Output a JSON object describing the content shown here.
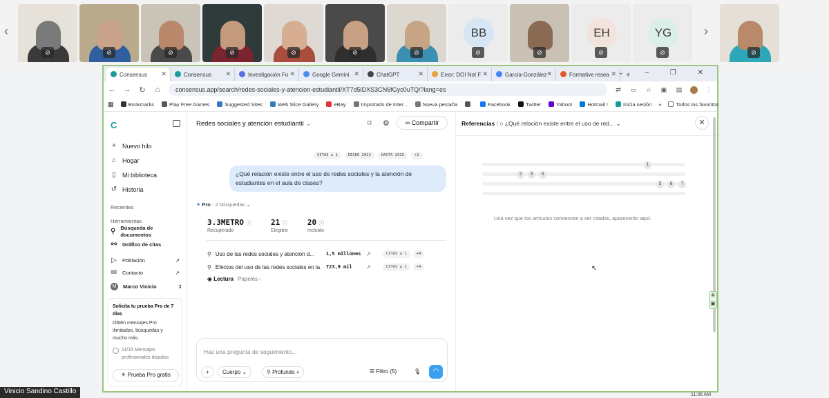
{
  "meeting": {
    "participants": [
      {
        "initials": "",
        "type": "video"
      },
      {
        "initials": "",
        "type": "video"
      },
      {
        "initials": "",
        "type": "video"
      },
      {
        "initials": "",
        "type": "video"
      },
      {
        "initials": "",
        "type": "video"
      },
      {
        "initials": "",
        "type": "video"
      },
      {
        "initials": "",
        "type": "video"
      },
      {
        "initials": "BB",
        "type": "avatar"
      },
      {
        "initials": "",
        "type": "video"
      },
      {
        "initials": "EH",
        "type": "avatar"
      },
      {
        "initials": "YG",
        "type": "avatar"
      },
      {
        "initials": "",
        "type": "video"
      }
    ],
    "speaker_name": "Vinicio Sandino Castillo",
    "avatar_colors": {
      "BB": "#d6e6f5",
      "EH": "#f2e4dc",
      "YG": "#dcefe6"
    }
  },
  "browser": {
    "tabs": [
      {
        "label": "Consensus",
        "active": true,
        "color": "#1a9c9c"
      },
      {
        "label": "Consensus",
        "active": false,
        "color": "#1a9c9c"
      },
      {
        "label": "Investigación Fo",
        "active": false,
        "color": "#5b6ee1"
      },
      {
        "label": "Google Gemini",
        "active": false,
        "color": "#4a8ef0"
      },
      {
        "label": "ChatGPT",
        "active": false,
        "color": "#444444"
      },
      {
        "label": "Error: DOI Not F",
        "active": false,
        "color": "#e6a23c"
      },
      {
        "label": "García-González",
        "active": false,
        "color": "#4285f4"
      },
      {
        "label": "Formative resea",
        "active": false,
        "color": "#e05a2b"
      }
    ],
    "url": "consensus.app/search/redes-sociales-y-atencion-estudiantil/XT7d5lDXS3CN6fGyc0uTQ/?lang=es",
    "bookmarks": [
      {
        "label": "Bookmarks",
        "color": "#333333"
      },
      {
        "label": "Play Free Games",
        "color": "#555555"
      },
      {
        "label": "Suggested Sites",
        "color": "#3a78c2"
      },
      {
        "label": "Web Slice Gallery",
        "color": "#3a78c2"
      },
      {
        "label": "eBay",
        "color": "#e53238"
      },
      {
        "label": "Importado de Inter...",
        "color": "#777777"
      },
      {
        "label": "Nueva pestaña",
        "color": "#777777"
      },
      {
        "label": "",
        "color": "#555555"
      },
      {
        "label": "Facebook",
        "color": "#1877f2"
      },
      {
        "label": "Twitter",
        "color": "#111111"
      },
      {
        "label": "Yahoo!",
        "color": "#6001d2"
      },
      {
        "label": "Hotmail !",
        "color": "#0078d4"
      },
      {
        "label": "Inicia sesión",
        "color": "#1a9c9c"
      }
    ],
    "bookmarks_more": "»",
    "all_favorites": "Todos los favoritos"
  },
  "sidebar": {
    "items": [
      {
        "icon": "plus-icon",
        "glyph": "+",
        "label": "Nuevo hilo"
      },
      {
        "icon": "home-icon",
        "glyph": "⌂",
        "label": "Hogar"
      },
      {
        "icon": "library-icon",
        "glyph": "▯",
        "label": "Mi biblioteca"
      },
      {
        "icon": "history-icon",
        "glyph": "↺",
        "label": "Historia"
      }
    ],
    "recent_label": "Recientes",
    "tools_label": "Herramientas",
    "tools": [
      {
        "icon": "search-icon",
        "glyph": "⚲",
        "label": "Búsqueda de documentos"
      },
      {
        "icon": "graph-icon",
        "glyph": "⚯",
        "label": "Gráfico de citas"
      }
    ],
    "links": [
      {
        "icon": "play-icon",
        "glyph": "▷",
        "label": "Población"
      },
      {
        "icon": "mail-icon",
        "glyph": "✉",
        "label": "Contacto"
      }
    ],
    "external_glyph": "↗",
    "user": {
      "initial": "M",
      "name": "Marco Vinicio"
    },
    "pro_card": {
      "title": "Solicita tu prueba Pro de 7 días",
      "body": "Obtén mensajes Pro ilimitados, búsquedas y mucho más.",
      "usage": "11/15 Mensajes profesionales dejados",
      "button": "Prueba Pro gratis"
    }
  },
  "main": {
    "thread_title": "Redes sociales y atención estudiantil",
    "share_label": "Compartir",
    "filters": [
      "CITAS ≥ 1",
      "DESDE 2021",
      "HASTA 2026",
      "+2"
    ],
    "question": "¿Qué relación existe entre el uso de redes sociales y la atención de estudiantes en el aula de clases?",
    "pro_label": "Pro",
    "searches": "2 búsquedas",
    "stats": [
      {
        "value": "3.3METRO",
        "label": "Recuperado"
      },
      {
        "value": "21",
        "label": "Elegible"
      },
      {
        "value": "20",
        "label": "Incluido"
      }
    ],
    "results": [
      {
        "text": "Uso de las redes sociales y atención d...",
        "count": "1,5 millones",
        "chip": "CITAS ≥ 1",
        "more": "+4"
      },
      {
        "text": "Efectos del uso de las redes sociales en la...",
        "count": "723,9 mil",
        "chip": "CITAS ≥ 1",
        "more": "+4"
      }
    ],
    "reading_label": "Lectura",
    "reading_sub": "Papeles",
    "composer": {
      "placeholder": "Haz una pregunta de seguimiento...",
      "body_label": "Cuerpo",
      "deep_label": "Profundo",
      "filter_label": "Filtro (5)"
    }
  },
  "refs": {
    "title": "Referencias",
    "separator": "/",
    "query": "¿Qué relación existe entre el uso de red...",
    "citations": [
      "1",
      "2",
      "3",
      "4",
      "5",
      "6",
      "7"
    ],
    "empty": "Una vez que los artículos comiencen a ser citados, aparecerán aquí."
  },
  "taskbar": {
    "clock": "11:36 AM"
  }
}
